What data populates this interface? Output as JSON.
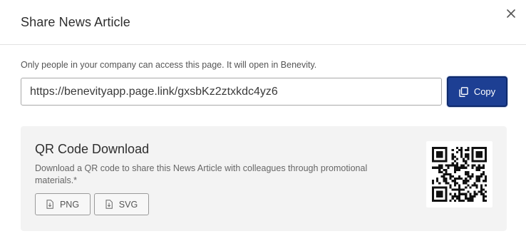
{
  "dialog": {
    "title": "Share News Article",
    "close_icon": "close-icon"
  },
  "share": {
    "notice": "Only people in your company can access this page. It will open in Benevity.",
    "link_value": "https://benevityapp.page.link/gxsbKz2ztxkdc4yz6",
    "copy_label": "Copy",
    "copy_icon": "copy-icon"
  },
  "qr": {
    "title": "QR Code Download",
    "description": "Download a QR code to share this News Article with colleagues through promotional materials.*",
    "png_label": "PNG",
    "svg_label": "SVG",
    "file_icon": "file-download-icon",
    "image": "qr-code-image"
  },
  "colors": {
    "primary": "#1d3f93",
    "panel_bg": "#f3f3f3"
  }
}
